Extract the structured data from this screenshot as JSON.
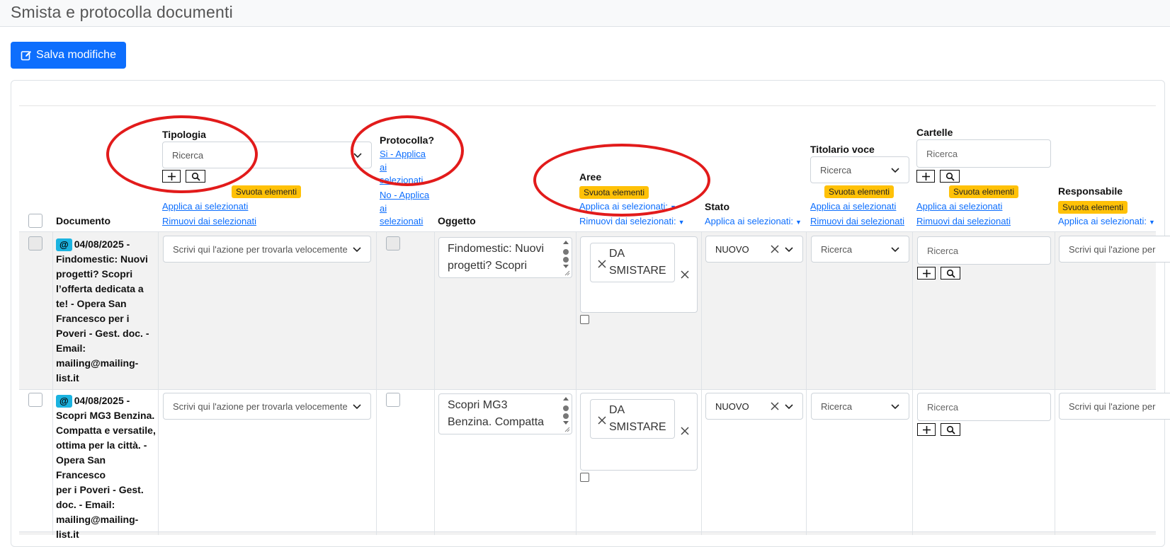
{
  "page": {
    "title": "Smista e protocolla documenti",
    "save_label": "Salva modifiche"
  },
  "header": {
    "documento": "Documento",
    "tipologia": {
      "label": "Tipologia",
      "placeholder": "Ricerca",
      "clear": "Svuota elementi",
      "apply": "Applica ai selezionati",
      "remove": "Rimuovi dai selezionati"
    },
    "protocolla": {
      "label": "Protocolla?",
      "yes_lines": [
        "Si - Applica",
        "ai",
        "selezionati"
      ],
      "no_lines": [
        "No - Applica",
        "ai",
        "selezionati"
      ]
    },
    "oggetto": "Oggetto",
    "aree": {
      "label": "Aree",
      "clear": "Svuota elementi",
      "apply": "Applica ai selezionati:",
      "remove": "Rimuovi dai selezionati:"
    },
    "stato": {
      "label": "Stato",
      "apply": "Applica ai selezionati:"
    },
    "titolario": {
      "label": "Titolario voce",
      "placeholder": "Ricerca",
      "clear": "Svuota elementi",
      "apply": "Applica ai selezionati",
      "remove": "Rimuovi dai selezionati"
    },
    "cartelle": {
      "label": "Cartelle",
      "placeholder": "Ricerca",
      "clear": "Svuota elementi",
      "apply": "Applica ai selezionati",
      "remove": "Rimuovi dai selezionati"
    },
    "responsabile": {
      "label": "Responsabile",
      "clear": "Svuota elementi",
      "apply": "Applica ai selezionati:"
    }
  },
  "rows": [
    {
      "badge": "@",
      "doc_lines": [
        "04/08/2025 -",
        "Findomestic: Nuovi",
        "progetti? Scopri",
        "l’offerta dedicata a",
        "te! - Opera San",
        "Francesco per i",
        "Poveri - Gest. doc. -",
        "Email:",
        "mailing@mailing-",
        "list.it"
      ],
      "azione_placeholder": "Scrivi qui l'azione per trovarla velocemente",
      "oggetto_lines": [
        "Findomestic: Nuovi",
        "progetti? Scopri"
      ],
      "area_tag_lines": [
        "DA",
        "SMISTARE"
      ],
      "stato": "NUOVO",
      "titolario_placeholder": "Ricerca",
      "cartelle_placeholder": "Ricerca",
      "responsabile_placeholder": "Scrivi qui l'azione per"
    },
    {
      "badge": "@",
      "doc_lines": [
        "04/08/2025 -",
        "Scopri MG3 Benzina.",
        "Compatta e versatile,",
        "ottima per la città. -",
        "Opera San Francesco",
        "per i Poveri - Gest.",
        "doc. - Email:",
        "mailing@mailing-",
        "list.it"
      ],
      "azione_placeholder": "Scrivi qui l'azione per trovarla velocemente",
      "oggetto_lines": [
        "Scopri MG3",
        "Benzina. Compatta"
      ],
      "area_tag_lines": [
        "DA",
        "SMISTARE"
      ],
      "stato": "NUOVO",
      "titolario_placeholder": "Ricerca",
      "cartelle_placeholder": "Ricerca",
      "responsabile_placeholder": "Scrivi qui l'azione per"
    }
  ],
  "colors": {
    "primary": "#0d6efd",
    "warning": "#ffc107",
    "email_badge": "#1bb3e0",
    "annotation_ring": "#e21b1b",
    "row_shade": "#f2f2f2"
  }
}
